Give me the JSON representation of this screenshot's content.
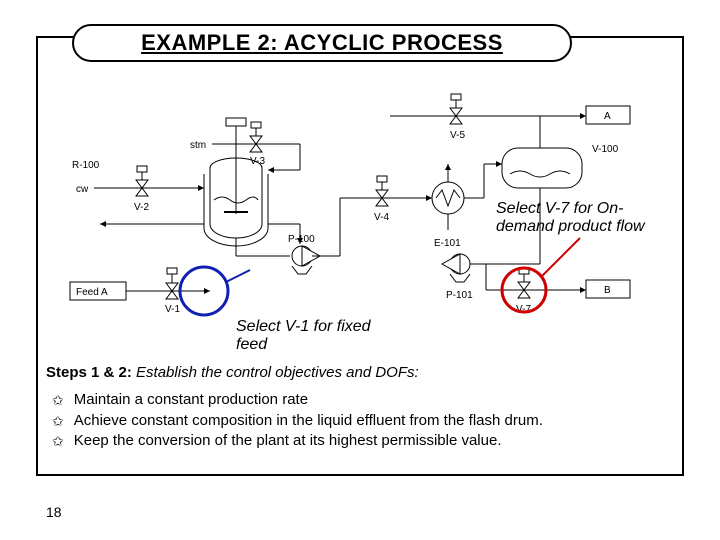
{
  "title": "EXAMPLE 2: ACYCLIC PROCESS",
  "annotations": {
    "v7": "Select V-7 for On-demand product flow",
    "v1": "Select V-1 for fixed feed"
  },
  "steps": {
    "prefix": "Steps 1 & 2:",
    "rest": " Establish the control objectives and DOFs:"
  },
  "bullets": [
    "Maintain a constant production rate",
    "Achieve constant composition in the liquid effluent from the flash drum.",
    "Keep the conversion of the plant at its highest permissible value."
  ],
  "page_number": "18",
  "equipment_labels": {
    "r100": "R-100",
    "v100": "V-100",
    "p100": "P-100",
    "p101": "P-101",
    "e101": "E-101",
    "v1": "V-1",
    "v2": "V-2",
    "v3": "V-3",
    "v4": "V-4",
    "v5": "V-5",
    "v7": "V-7",
    "feedA": "Feed A",
    "cw": "cw",
    "stm": "stm",
    "A": "A",
    "B": "B"
  }
}
